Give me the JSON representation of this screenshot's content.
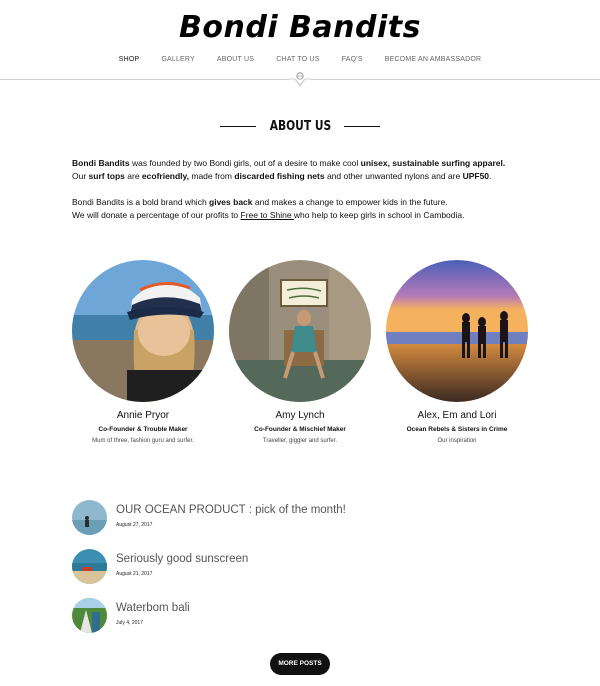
{
  "site": {
    "logo": "Bondi Bandits"
  },
  "nav": {
    "items": [
      "SHOP",
      "GALLERY",
      "ABOUT US",
      "CHAT TO US",
      "FAQ'S",
      "BECOME AN AMBASSADOR"
    ],
    "active": "SHOP"
  },
  "about": {
    "heading": "ABOUT US",
    "p1": {
      "brand": "Bondi Bandits",
      "t1": " was founded by two Bondi girls, out of a desire to make cool ",
      "b1": "unisex, sustainable surfing apparel.",
      "t2": "Our ",
      "b2": "surf tops",
      "t3": " are ",
      "b3": "ecofriendly,",
      "t4": " made from ",
      "b4": "discarded fishing nets",
      "t5": " and other unwanted nylons and are ",
      "b5": "UPF50",
      "t6": "."
    },
    "p2": {
      "t1": "Bondi Bandits is a bold brand which ",
      "b1": "gives back",
      "t2": " and makes a change to empower kids in the future.",
      "t3": "We will donate a percentage of our profits to ",
      "link": "Free to Shine ",
      "t4": "who help to keep girls in school in Cambodia."
    }
  },
  "team": [
    {
      "name": "Annie Pryor",
      "role": "Co-Founder & Trouble Maker",
      "desc": "Mum of three, fashion guru and surfer."
    },
    {
      "name": "Amy Lynch",
      "role": "Co-Founder & Mischief Maker",
      "desc": "Traveller, giggler and surfer."
    },
    {
      "name": "Alex, Em and Lori",
      "role": "Ocean Rebels & Sisters in Crime",
      "desc": "Our inspiration"
    }
  ],
  "posts": [
    {
      "title": "OUR OCEAN PRODUCT : pick of the month!",
      "date": "August 27, 2017"
    },
    {
      "title": "Seriously good sunscreen",
      "date": "August 21, 2017"
    },
    {
      "title": "Waterbom bali",
      "date": "July 4, 2017"
    }
  ],
  "more_button": "MORE POSTS"
}
